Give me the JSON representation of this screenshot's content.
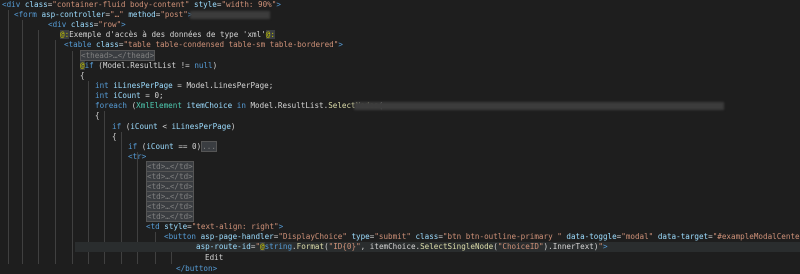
{
  "editor": {
    "lines": [
      {
        "segments": [
          {
            "cls": "t-tag",
            "t": "<div "
          },
          {
            "cls": "t-attr",
            "t": "class"
          },
          {
            "cls": "t-text",
            "t": "="
          },
          {
            "cls": "t-str",
            "t": "\"container-fluid body-content\""
          },
          {
            "cls": "t-attr",
            "t": " style"
          },
          {
            "cls": "t-text",
            "t": "="
          },
          {
            "cls": "t-str",
            "t": "\"width: 90%\""
          },
          {
            "cls": "t-tag",
            "t": ">"
          }
        ]
      },
      {
        "segments": [
          {
            "cls": "t-tag",
            "t": "<form "
          },
          {
            "cls": "t-attr",
            "t": "asp-controller"
          },
          {
            "cls": "t-text",
            "t": "="
          },
          {
            "cls": "t-str",
            "t": "\"…\""
          },
          {
            "cls": "t-attr",
            "t": " method"
          },
          {
            "cls": "t-text",
            "t": "="
          },
          {
            "cls": "t-str",
            "t": "\"post\""
          },
          {
            "cls": "t-tag",
            "t": ">"
          }
        ]
      },
      {
        "segments": [
          {
            "cls": "t-tag",
            "t": "<div "
          },
          {
            "cls": "t-attr",
            "t": "class"
          },
          {
            "cls": "t-text",
            "t": "="
          },
          {
            "cls": "t-str",
            "t": "\"row\""
          },
          {
            "cls": "t-tag",
            "t": ">"
          }
        ]
      },
      {
        "segments": [
          {
            "cls": "t-razor",
            "t": "@:"
          },
          {
            "cls": "t-text",
            "t": "Exemple d'accès à des données de type 'xml'"
          },
          {
            "cls": "t-razor",
            "t": "@:"
          }
        ]
      },
      {
        "segments": [
          {
            "cls": "t-tag",
            "t": "<table "
          },
          {
            "cls": "t-attr",
            "t": "class"
          },
          {
            "cls": "t-text",
            "t": "="
          },
          {
            "cls": "t-str",
            "t": "\"table table-condensed table-sm table-bordered\""
          },
          {
            "cls": "t-tag",
            "t": ">"
          }
        ]
      },
      {
        "segments": [
          {
            "cls": "t-fold",
            "t": "<thead>…</thead>"
          }
        ]
      },
      {
        "segments": [
          {
            "cls": "t-razor",
            "t": "@"
          },
          {
            "cls": "t-kw",
            "t": "if"
          },
          {
            "cls": "t-text",
            "t": " (Model.ResultList != "
          },
          {
            "cls": "t-kw",
            "t": "null"
          },
          {
            "cls": "t-text",
            "t": ")"
          }
        ]
      },
      {
        "segments": [
          {
            "cls": "t-text",
            "t": "{"
          }
        ]
      },
      {
        "segments": [
          {
            "cls": "t-kw",
            "t": "int"
          },
          {
            "cls": "t-var",
            "t": " iLinesPerPage"
          },
          {
            "cls": "t-text",
            "t": " = Model.LinesPerPage;"
          }
        ]
      },
      {
        "segments": [
          {
            "cls": "t-kw",
            "t": "int"
          },
          {
            "cls": "t-var",
            "t": " iCount"
          },
          {
            "cls": "t-text",
            "t": " = 0;"
          }
        ]
      },
      {
        "segments": [
          {
            "cls": "t-kw",
            "t": "foreach"
          },
          {
            "cls": "t-text",
            "t": " ("
          },
          {
            "cls": "t-type",
            "t": "XmlElement"
          },
          {
            "cls": "t-var",
            "t": " itemChoice"
          },
          {
            "cls": "t-kw",
            "t": " in"
          },
          {
            "cls": "t-text",
            "t": " Model.ResultList."
          },
          {
            "cls": "t-fn",
            "t": "SelectNodes"
          },
          {
            "cls": "t-text",
            "t": "("
          }
        ]
      },
      {
        "segments": [
          {
            "cls": "t-text",
            "t": "{"
          }
        ]
      },
      {
        "segments": [
          {
            "cls": "t-kw",
            "t": "if"
          },
          {
            "cls": "t-text",
            "t": " ("
          },
          {
            "cls": "t-var",
            "t": "iCount"
          },
          {
            "cls": "t-text",
            "t": " < "
          },
          {
            "cls": "t-var",
            "t": "iLinesPerPage"
          },
          {
            "cls": "t-text",
            "t": ")"
          }
        ]
      },
      {
        "segments": [
          {
            "cls": "t-text",
            "t": "{"
          }
        ]
      },
      {
        "segments": [
          {
            "cls": "t-kw",
            "t": "if"
          },
          {
            "cls": "t-text",
            "t": " ("
          },
          {
            "cls": "t-var",
            "t": "iCount"
          },
          {
            "cls": "t-text",
            "t": " == 0)"
          },
          {
            "cls": "t-fold",
            "t": "..."
          }
        ]
      },
      {
        "segments": [
          {
            "cls": "t-tag",
            "t": "<tr>"
          }
        ]
      },
      {
        "segments": [
          {
            "cls": "t-fold",
            "t": "<td>…</td>"
          }
        ]
      },
      {
        "segments": [
          {
            "cls": "t-fold",
            "t": "<td>…</td>"
          }
        ]
      },
      {
        "segments": [
          {
            "cls": "t-fold",
            "t": "<td>…</td>"
          }
        ]
      },
      {
        "segments": [
          {
            "cls": "t-fold",
            "t": "<td>…</td>"
          }
        ]
      },
      {
        "segments": [
          {
            "cls": "t-fold",
            "t": "<td>…</td>"
          }
        ]
      },
      {
        "segments": [
          {
            "cls": "t-fold",
            "t": "<td>…</td>"
          }
        ]
      },
      {
        "segments": [
          {
            "cls": "t-tag",
            "t": "<td "
          },
          {
            "cls": "t-attr",
            "t": "style"
          },
          {
            "cls": "t-text",
            "t": "="
          },
          {
            "cls": "t-str",
            "t": "\"text-align: right\""
          },
          {
            "cls": "t-tag",
            "t": ">"
          }
        ]
      },
      {
        "segments": [
          {
            "cls": "t-tag",
            "t": "<button "
          },
          {
            "cls": "t-attr",
            "t": "asp-page-handler"
          },
          {
            "cls": "t-text",
            "t": "="
          },
          {
            "cls": "t-str",
            "t": "\"DisplayChoice\""
          },
          {
            "cls": "t-attr",
            "t": " type"
          },
          {
            "cls": "t-text",
            "t": "="
          },
          {
            "cls": "t-str",
            "t": "\"submit\""
          },
          {
            "cls": "t-attr",
            "t": " class"
          },
          {
            "cls": "t-text",
            "t": "="
          },
          {
            "cls": "t-str",
            "t": "\"btn btn-outline-primary \""
          },
          {
            "cls": "t-attr",
            "t": " data-toggle"
          },
          {
            "cls": "t-text",
            "t": "="
          },
          {
            "cls": "t-str",
            "t": "\"modal\""
          },
          {
            "cls": "t-attr",
            "t": " data-target"
          },
          {
            "cls": "t-text",
            "t": "="
          },
          {
            "cls": "t-str",
            "t": "\"#exampleModalCenter\""
          }
        ]
      },
      {
        "segments": [
          {
            "cls": "t-attr",
            "t": "asp-route-id"
          },
          {
            "cls": "t-text",
            "t": "="
          },
          {
            "cls": "t-str",
            "t": "\""
          },
          {
            "cls": "t-razor",
            "t": "@"
          },
          {
            "cls": "t-kw",
            "t": "string"
          },
          {
            "cls": "t-text",
            "t": "."
          },
          {
            "cls": "t-fn",
            "t": "Format"
          },
          {
            "cls": "t-text",
            "t": "("
          },
          {
            "cls": "t-str",
            "t": "\"ID{0}\""
          },
          {
            "cls": "t-text",
            "t": ", itemChoice."
          },
          {
            "cls": "t-fn",
            "t": "SelectSingleNode"
          },
          {
            "cls": "t-text",
            "t": "("
          },
          {
            "cls": "t-str",
            "t": "\"ChoiceID\""
          },
          {
            "cls": "t-text",
            "t": ").InnerText)"
          },
          {
            "cls": "t-str",
            "t": "\""
          },
          {
            "cls": "t-tag",
            "t": ">"
          }
        ]
      },
      {
        "segments": [
          {
            "cls": "t-text",
            "t": "Edit"
          }
        ]
      },
      {
        "segments": [
          {
            "cls": "t-tag",
            "t": "</button>"
          }
        ]
      }
    ]
  }
}
